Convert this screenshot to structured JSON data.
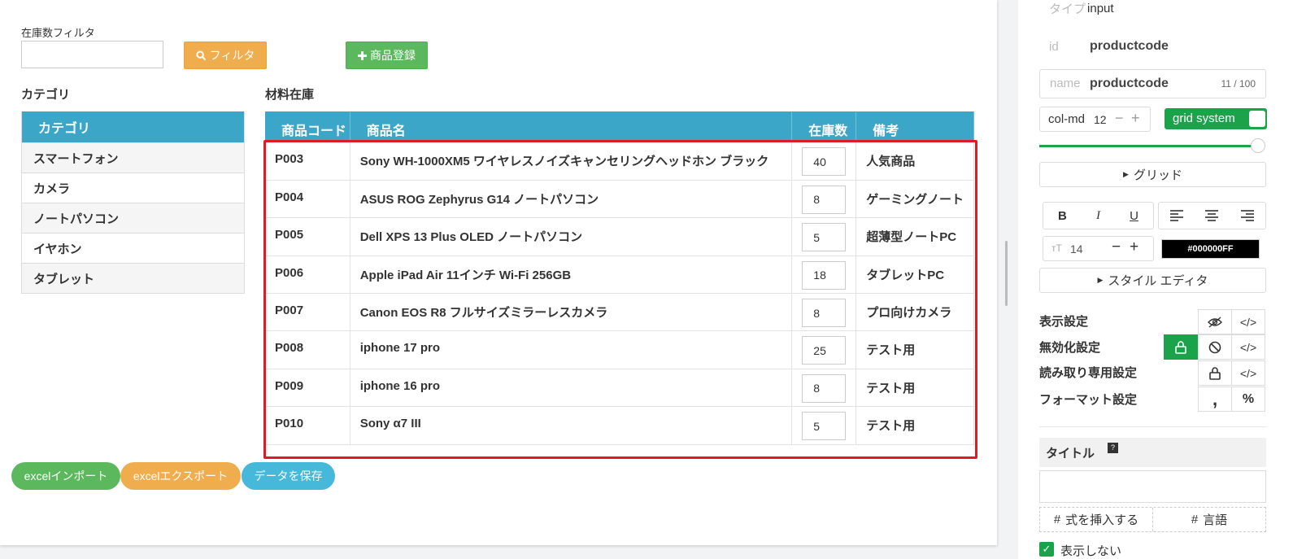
{
  "filter": {
    "label": "在庫数フィルタ",
    "value": "",
    "button": "フィルタ"
  },
  "add_button": "商品登録",
  "category": {
    "title": "カテゴリ",
    "header": "カテゴリ",
    "items": [
      "スマートフォン",
      "カメラ",
      "ノートパソコン",
      "イヤホン",
      "タブレット"
    ]
  },
  "inventory": {
    "title": "材料在庫",
    "columns": [
      "商品コード",
      "商品名",
      "在庫数",
      "備考"
    ],
    "rows": [
      {
        "code": "P003",
        "name": "Sony WH-1000XM5 ワイヤレスノイズキャンセリングヘッドホン ブラック",
        "qty": "40",
        "note": "人気商品"
      },
      {
        "code": "P004",
        "name": "ASUS ROG Zephyrus G14 ノートパソコン",
        "qty": "8",
        "note": "ゲーミングノート"
      },
      {
        "code": "P005",
        "name": "Dell XPS 13 Plus OLED ノートパソコン",
        "qty": "5",
        "note": "超薄型ノートPC"
      },
      {
        "code": "P006",
        "name": "Apple iPad Air 11インチ Wi-Fi 256GB",
        "qty": "18",
        "note": "タブレットPC"
      },
      {
        "code": "P007",
        "name": "Canon EOS R8 フルサイズミラーレスカメラ",
        "qty": "8",
        "note": "プロ向けカメラ"
      },
      {
        "code": "P008",
        "name": "iphone 17 pro",
        "qty": "25",
        "note": "テスト用"
      },
      {
        "code": "P009",
        "name": "iphone 16 pro",
        "qty": "8",
        "note": "テスト用"
      },
      {
        "code": "P010",
        "name": "Sony α7 III",
        "qty": "5",
        "note": "テスト用"
      }
    ]
  },
  "footer_buttons": {
    "import": "excelインポート",
    "export": "excelエクスポート",
    "save": "データを保存"
  },
  "props": {
    "type_label": "タイプ",
    "type_value": "input",
    "id_label": "id",
    "id_value": "productcode",
    "name_label": "name",
    "name_value": "productcode",
    "name_count": "11 / 100",
    "col_label": "col-md",
    "col_value": "12",
    "grid_toggle": "grid system",
    "grid_section": "グリッド",
    "font_size": "14",
    "color_value": "#000000FF",
    "style_editor": "スタイル エディタ",
    "settings": [
      "表示設定",
      "無効化設定",
      "読み取り専用設定",
      "フォーマット設定"
    ],
    "title_label": "タイトル",
    "title_value": "",
    "insert_formula": "式を挿入する",
    "language": "言語",
    "hide_label": "表示しない"
  },
  "colors": {
    "header_blue": "#3ca6c8",
    "green": "#5cb85c",
    "orange": "#f0ad4e",
    "highlight_red": "#e01b24"
  }
}
